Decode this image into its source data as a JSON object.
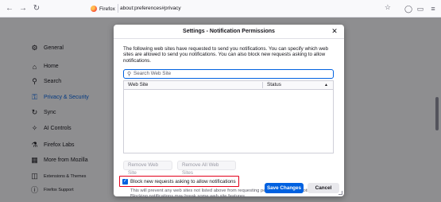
{
  "toolbar": {
    "back_icon": "arrow-left-icon",
    "forward_icon": "arrow-right-icon",
    "reload_icon": "reload-icon",
    "identity_label": "Firefox",
    "url": "about:preferences#privacy",
    "bookmark_icon": "star-icon",
    "right_icons": [
      "account-icon",
      "extensions-icon",
      "menu-icon"
    ]
  },
  "sidebar": {
    "items": [
      {
        "label": "General",
        "icon": "gear-icon"
      },
      {
        "label": "Home",
        "icon": "home-icon"
      },
      {
        "label": "Search",
        "icon": "search-icon"
      },
      {
        "label": "Privacy & Security",
        "icon": "lock-icon",
        "selected": true
      },
      {
        "label": "Sync",
        "icon": "sync-icon"
      },
      {
        "label": "AI Controls",
        "icon": "ai-icon"
      },
      {
        "label": "Firefox Labs",
        "icon": "flask-icon"
      },
      {
        "label": "More from Mozilla",
        "icon": "mozilla-icon"
      },
      {
        "label": "Extensions & Themes",
        "icon": "puzzle-icon"
      },
      {
        "label": "Firefox Support",
        "icon": "help-icon"
      }
    ]
  },
  "dialog": {
    "title": "Settings - Notification Permissions",
    "close_icon": "close-icon",
    "description": "The following web sites have requested to send you notifications. You can specify which web sites are allowed to send you notifications. You can also block new requests asking to allow notifications.",
    "search_placeholder": "Search Web Site",
    "table": {
      "columns": [
        "Web Site",
        "Status"
      ],
      "rows": []
    },
    "remove_button": "Remove Web Site",
    "remove_all_button": "Remove All Web Sites",
    "block_checkbox": {
      "label": "Block new requests asking to allow notifications",
      "checked": true
    },
    "block_hint": "This will prevent any web sites not listed above from requesting permission to send notifications. Blocking notifications may break some web site features.",
    "save_button": "Save Changes",
    "cancel_button": "Cancel"
  },
  "colors": {
    "accent": "#0061e0",
    "highlight": "#e3001b"
  }
}
